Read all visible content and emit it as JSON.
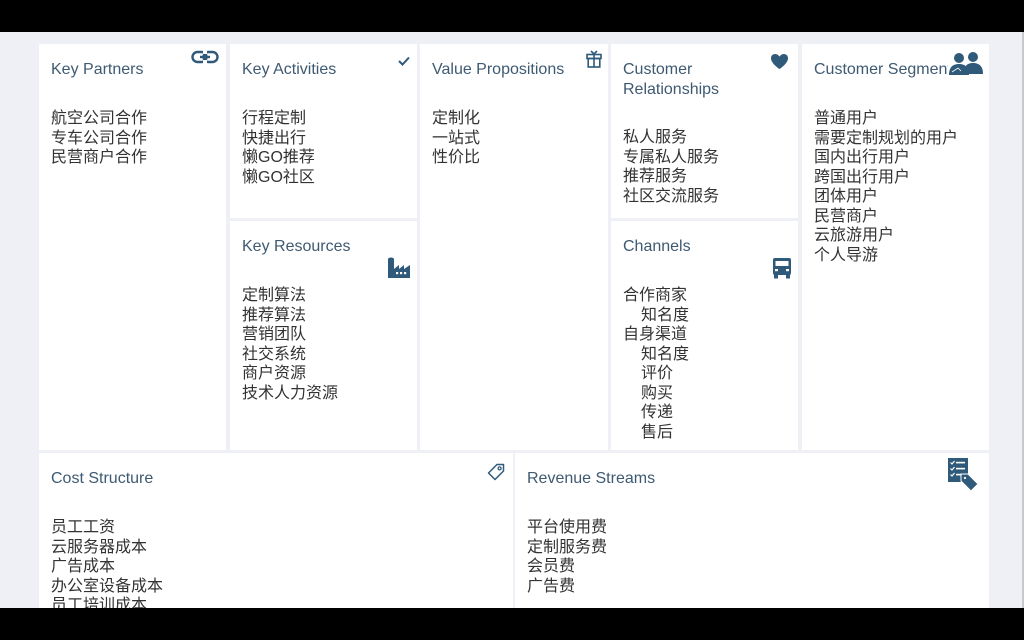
{
  "canvas": {
    "accent_color": "#2f5a7a",
    "title_color": "#3e5a72",
    "key_partners": {
      "title": "Key Partners",
      "icon": "link-icon",
      "items": [
        "航空公司合作",
        "专车公司合作",
        "民营商户合作"
      ]
    },
    "key_activities": {
      "title": "Key Activities",
      "icon": "checkmark-icon",
      "items": [
        "行程定制",
        "快捷出行",
        "懒GO推荐",
        "懒GO社区"
      ]
    },
    "key_resources": {
      "title": "Key Resources",
      "icon": "factory-icon",
      "items": [
        "定制算法",
        "推荐算法",
        "营销团队",
        "社交系统",
        "商户资源",
        "技术人力资源"
      ]
    },
    "value_propositions": {
      "title": "Value Propositions",
      "icon": "gift-icon",
      "items": [
        "定制化",
        "一站式",
        "性价比"
      ]
    },
    "customer_relationships": {
      "title": "Customer Relationships",
      "icon": "heart-icon",
      "items": [
        "私人服务",
        "专属私人服务",
        "推荐服务",
        "社区交流服务"
      ]
    },
    "channels": {
      "title": "Channels",
      "icon": "truck-icon",
      "items": [
        {
          "text": "合作商家",
          "indent": false
        },
        {
          "text": "知名度",
          "indent": true
        },
        {
          "text": "自身渠道",
          "indent": false
        },
        {
          "text": "知名度",
          "indent": true
        },
        {
          "text": "评价",
          "indent": true
        },
        {
          "text": "购买",
          "indent": true
        },
        {
          "text": "传递",
          "indent": true
        },
        {
          "text": "售后",
          "indent": true
        }
      ]
    },
    "customer_segments": {
      "title": "Customer Segments",
      "icon": "users-icon",
      "items": [
        "普通用户",
        "需要定制规划的用户",
        "国内出行用户",
        "跨国出行用户",
        "团体用户",
        "民营商户",
        "云旅游用户",
        "个人导游"
      ]
    },
    "cost_structure": {
      "title": "Cost Structure",
      "icon": "tag-icon",
      "items": [
        "员工工资",
        "云服务器成本",
        "广告成本",
        "办公室设备成本",
        "员工培训成本"
      ]
    },
    "revenue_streams": {
      "title": "Revenue Streams",
      "icon": "checklist-tag-icon",
      "items": [
        "平台使用费",
        "定制服务费",
        "会员费",
        "广告费"
      ]
    }
  }
}
